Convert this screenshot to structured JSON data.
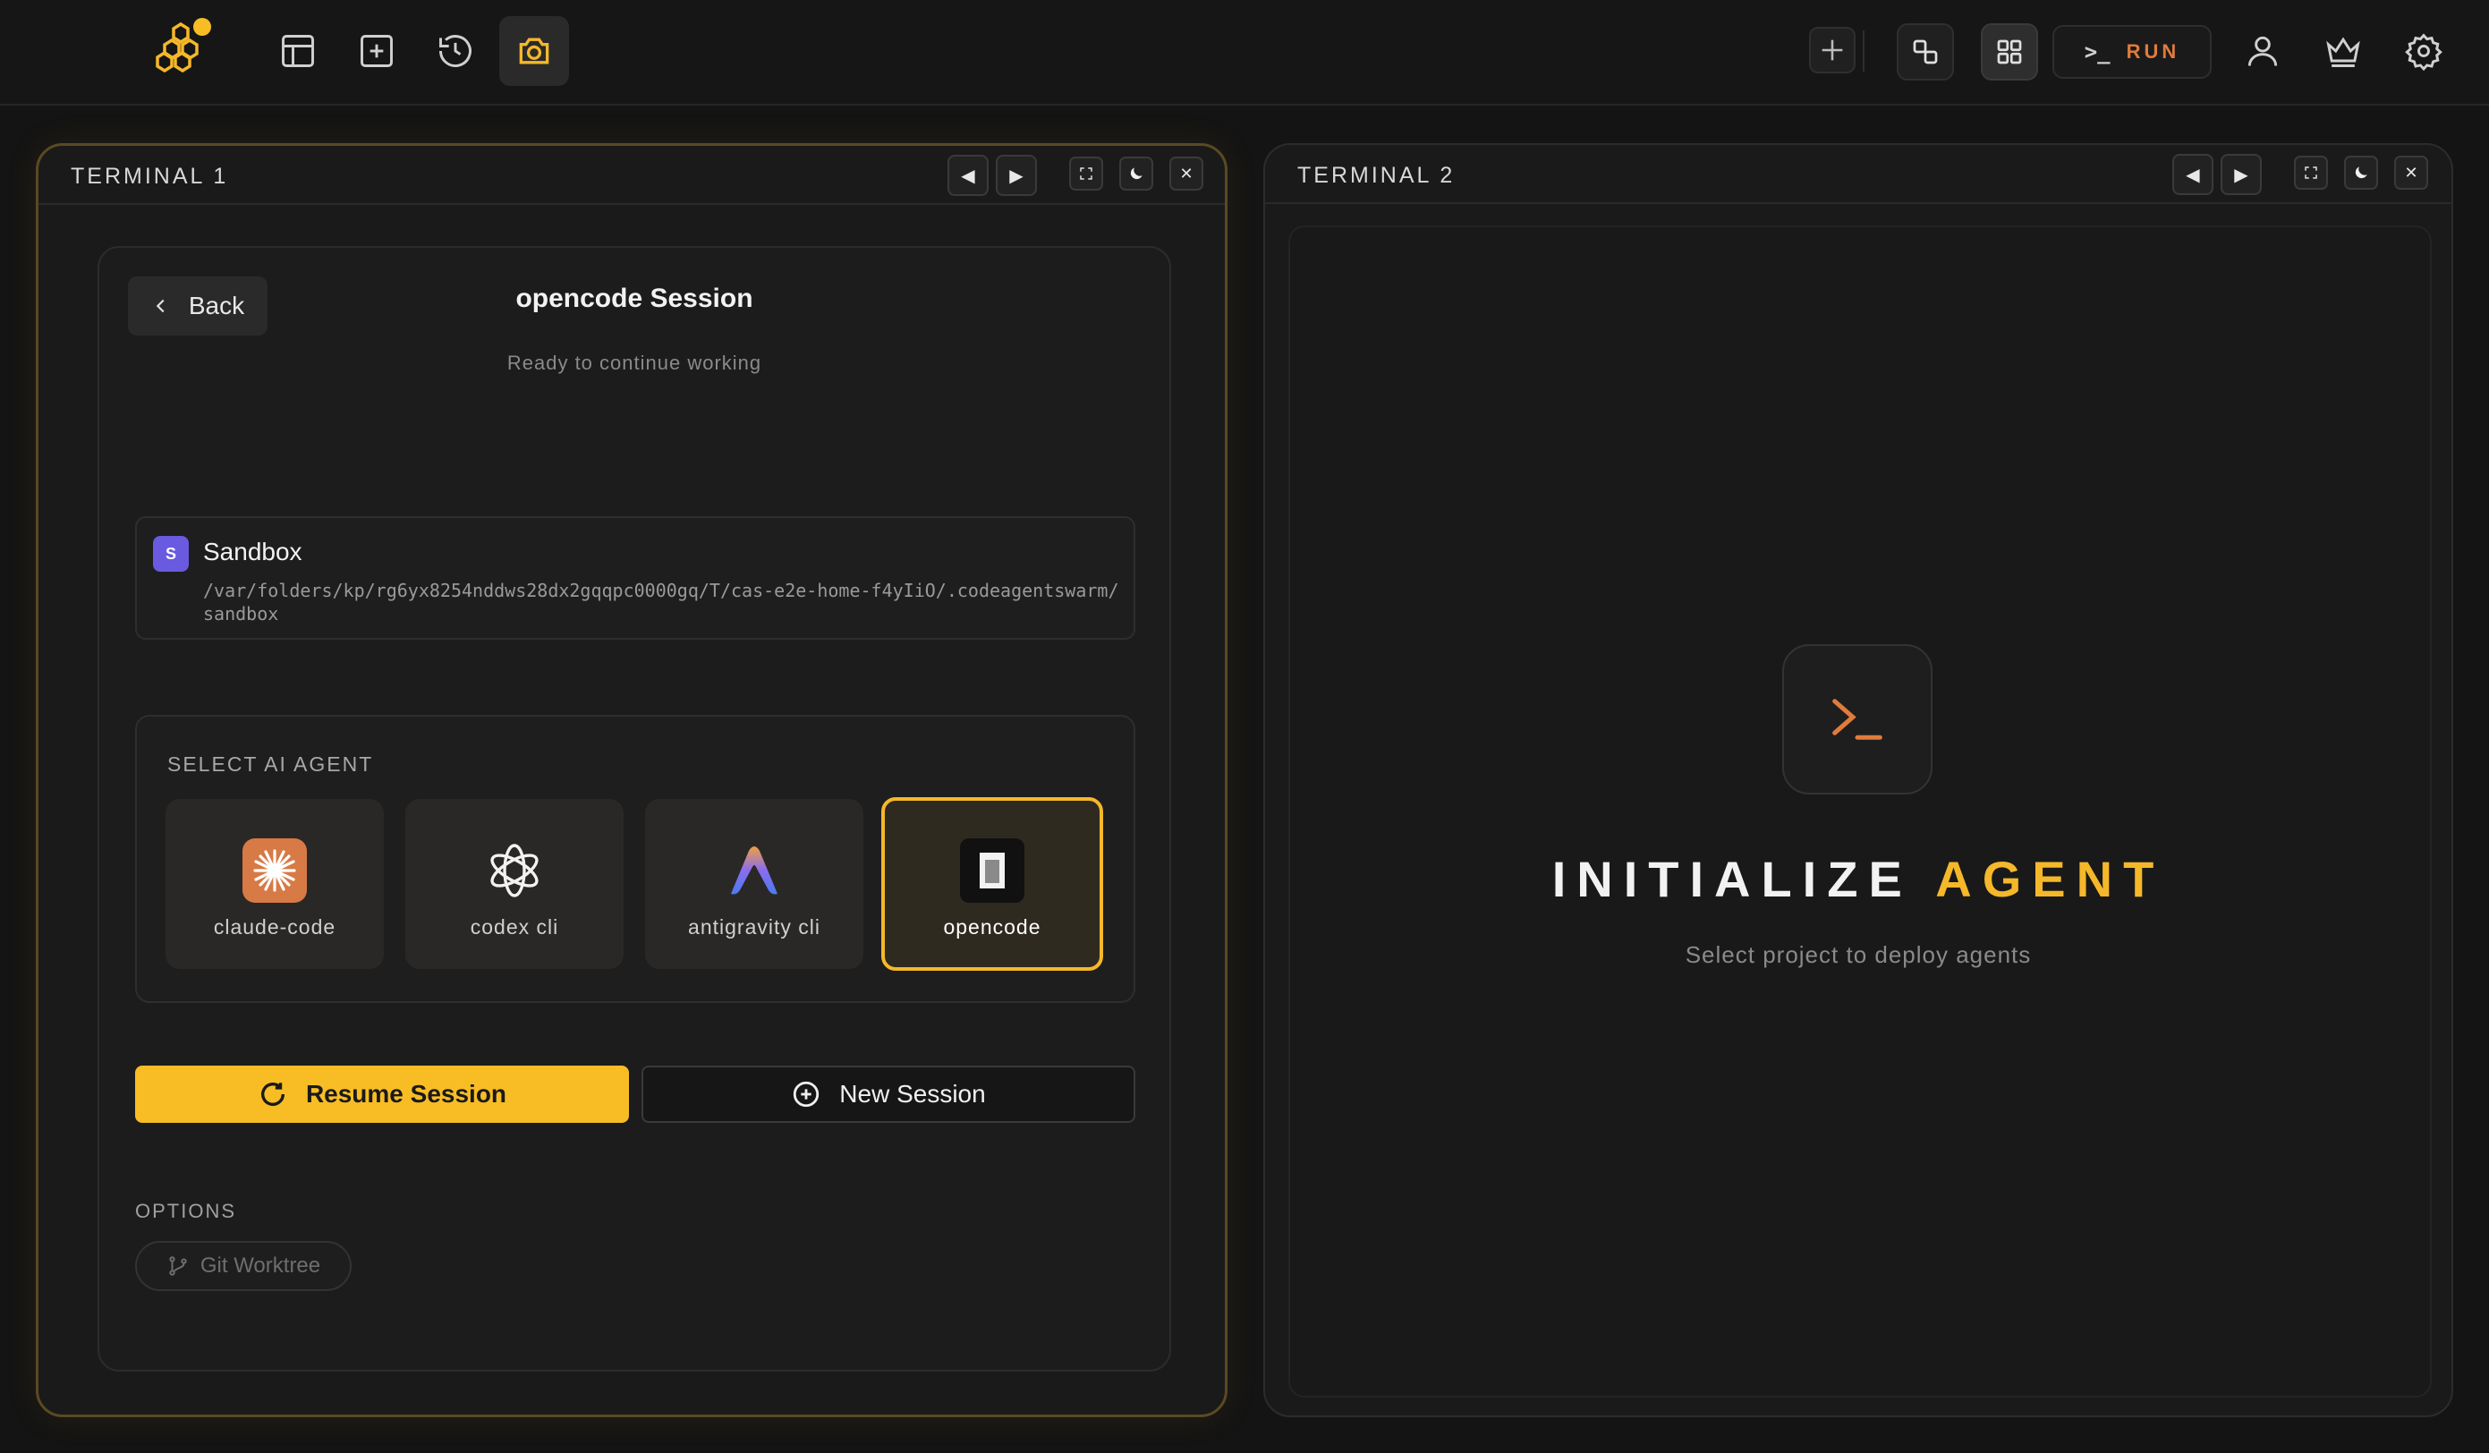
{
  "toolbar": {
    "icons": [
      "logo-icon",
      "layout-icon",
      "add-square-icon",
      "history-icon",
      "camera-icon",
      "plus-icon",
      "shapes-icon",
      "grid-icon",
      "user-icon",
      "crown-icon",
      "settings-icon"
    ],
    "run_prompt": ">_",
    "run_label": "RUN",
    "accent_color": "#f8bd25"
  },
  "terminal1": {
    "title": "TERMINAL 1",
    "card": {
      "back_label": "Back",
      "session_title": "opencode Session",
      "session_subtitle": "Ready to continue working",
      "project": {
        "badge": "S",
        "name": "Sandbox",
        "path": "/var/folders/kp/rg6yx8254nddws28dx2gqqpc0000gq/T/cas-e2e-home-f4yIiO/.codeagentswarm/sandbox"
      },
      "agent_section_label": "SELECT AI AGENT",
      "agents": [
        {
          "name": "claude-code",
          "selected": false
        },
        {
          "name": "codex cli",
          "selected": false
        },
        {
          "name": "antigravity cli",
          "selected": false
        },
        {
          "name": "opencode",
          "selected": true
        }
      ],
      "resume_label": "Resume Session",
      "new_label": "New Session",
      "options_label": "OPTIONS",
      "git_worktree_label": "Git Worktree"
    }
  },
  "terminal2": {
    "title": "TERMINAL 2",
    "init_title_main": "INITIALIZE",
    "init_title_accent": "AGENT",
    "init_subtitle": "Select project to deploy agents"
  }
}
